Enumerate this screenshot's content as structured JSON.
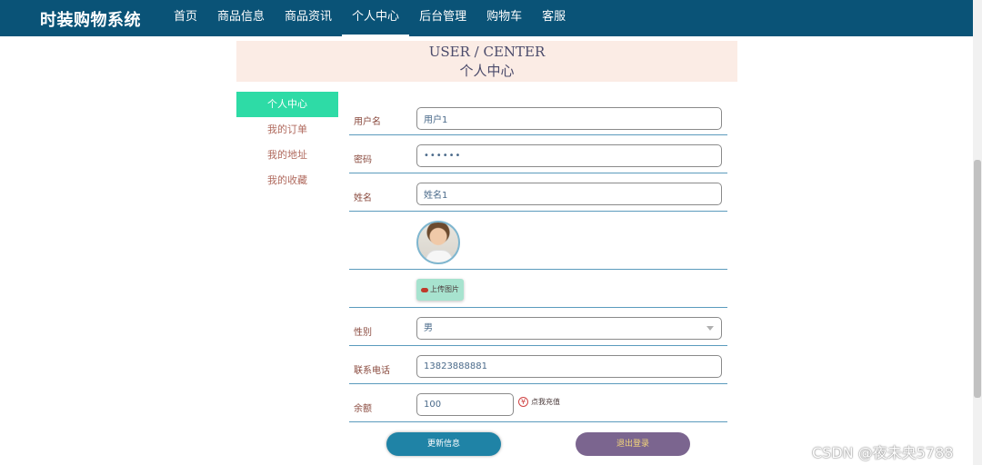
{
  "brand": "时装购物系统",
  "nav": [
    {
      "label": "首页",
      "active": false
    },
    {
      "label": "商品信息",
      "active": false
    },
    {
      "label": "商品资讯",
      "active": false
    },
    {
      "label": "个人中心",
      "active": true
    },
    {
      "label": "后台管理",
      "active": false
    },
    {
      "label": "购物车",
      "active": false
    },
    {
      "label": "客服",
      "active": false
    }
  ],
  "banner": {
    "en": "USER / CENTER",
    "cn": "个人中心"
  },
  "sidebar": [
    {
      "label": "个人中心",
      "active": true
    },
    {
      "label": "我的订单",
      "active": false
    },
    {
      "label": "我的地址",
      "active": false
    },
    {
      "label": "我的收藏",
      "active": false
    }
  ],
  "form": {
    "username": {
      "label": "用户名",
      "value": "用户1"
    },
    "password": {
      "label": "密码",
      "value": "••••••"
    },
    "name": {
      "label": "姓名",
      "value": "姓名1"
    },
    "upload_label": "上传图片",
    "gender": {
      "label": "性别",
      "value": "男"
    },
    "phone": {
      "label": "联系电话",
      "value": "13823888881"
    },
    "balance": {
      "label": "余额",
      "value": "100",
      "recharge_label": "点我充值"
    }
  },
  "buttons": {
    "update": "更新信息",
    "logout": "退出登录"
  },
  "watermark": "CSDN @夜未央5788",
  "colors": {
    "nav_bg": "#0a5377",
    "sidebar_active": "#2edba6",
    "update_btn": "#1f83a6",
    "logout_btn": "#7b658f"
  }
}
